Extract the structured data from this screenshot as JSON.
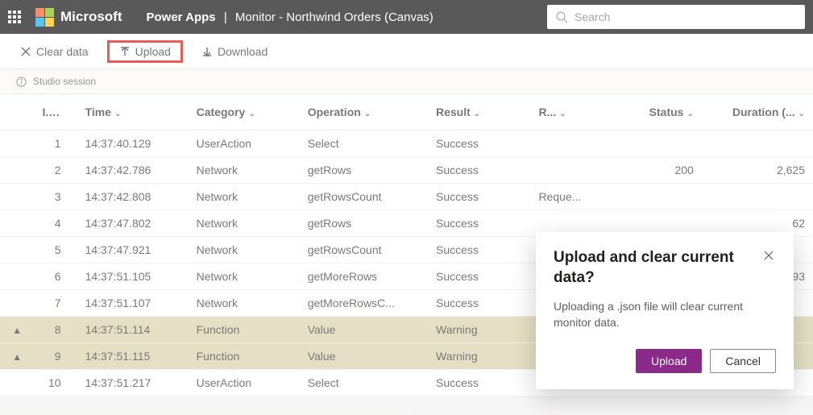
{
  "header": {
    "brand": "Microsoft",
    "app": "Power Apps",
    "page": "Monitor - Northwind Orders (Canvas)",
    "search_placeholder": "Search"
  },
  "toolbar": {
    "clear_label": "Clear data",
    "upload_label": "Upload",
    "download_label": "Download"
  },
  "session": {
    "label": "Studio session"
  },
  "table": {
    "headers": {
      "id": "I..",
      "time": "Time",
      "category": "Category",
      "operation": "Operation",
      "result": "Result",
      "r": "R...",
      "status": "Status",
      "duration": "Duration (..."
    },
    "rows": [
      {
        "warn": false,
        "id": "1",
        "time": "14:37:40.129",
        "category": "UserAction",
        "operation": "Select",
        "result": "Success",
        "r": "",
        "status": "",
        "duration": ""
      },
      {
        "warn": false,
        "id": "2",
        "time": "14:37:42.786",
        "category": "Network",
        "operation": "getRows",
        "result": "Success",
        "r": "",
        "status": "200",
        "duration": "2,625"
      },
      {
        "warn": false,
        "id": "3",
        "time": "14:37:42.808",
        "category": "Network",
        "operation": "getRowsCount",
        "result": "Success",
        "r": "Reque...",
        "status": "",
        "duration": ""
      },
      {
        "warn": false,
        "id": "4",
        "time": "14:37:47.802",
        "category": "Network",
        "operation": "getRows",
        "result": "Success",
        "r": "",
        "status": "",
        "duration": "62"
      },
      {
        "warn": false,
        "id": "5",
        "time": "14:37:47.921",
        "category": "Network",
        "operation": "getRowsCount",
        "result": "Success",
        "r": "",
        "status": "",
        "duration": ""
      },
      {
        "warn": false,
        "id": "6",
        "time": "14:37:51.105",
        "category": "Network",
        "operation": "getMoreRows",
        "result": "Success",
        "r": "",
        "status": "",
        "duration": "93"
      },
      {
        "warn": false,
        "id": "7",
        "time": "14:37:51.107",
        "category": "Network",
        "operation": "getMoreRowsC...",
        "result": "Success",
        "r": "",
        "status": "",
        "duration": ""
      },
      {
        "warn": true,
        "id": "8",
        "time": "14:37:51.114",
        "category": "Function",
        "operation": "Value",
        "result": "Warning",
        "r": "",
        "status": "",
        "duration": ""
      },
      {
        "warn": true,
        "id": "9",
        "time": "14:37:51.115",
        "category": "Function",
        "operation": "Value",
        "result": "Warning",
        "r": "",
        "status": "",
        "duration": ""
      },
      {
        "warn": false,
        "id": "10",
        "time": "14:37:51.217",
        "category": "UserAction",
        "operation": "Select",
        "result": "Success",
        "r": "",
        "status": "",
        "duration": ""
      }
    ]
  },
  "dialog": {
    "title": "Upload and clear current data?",
    "body": "Uploading a .json file will clear current monitor data.",
    "upload": "Upload",
    "cancel": "Cancel"
  }
}
